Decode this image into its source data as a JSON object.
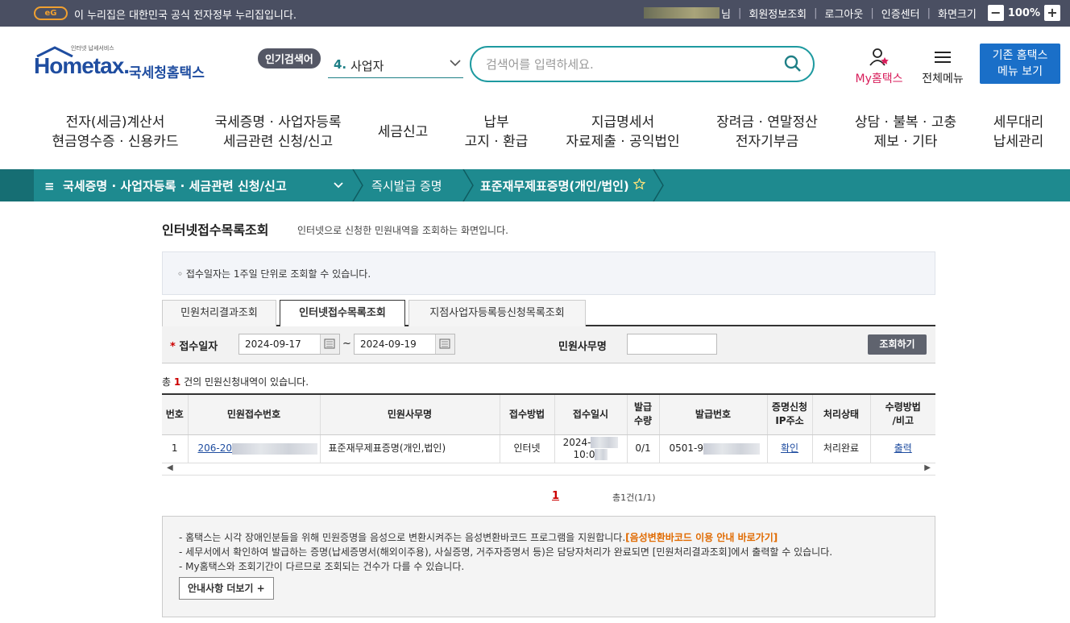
{
  "topbar": {
    "gov_text": "이 누리집은 대한민국 공식 전자정부 누리집입니다.",
    "eg_logo": "eG",
    "user_suffix": "님",
    "links": [
      "회원정보조회",
      "로그아웃",
      "인증센터",
      "화면크기"
    ],
    "zoom_minus": "−",
    "zoom_value": "100%",
    "zoom_plus": "+"
  },
  "header": {
    "logo_small": "인터넷 납세서비스",
    "logo_word": "Hometax.",
    "logo_kor": "국세청홈택스",
    "popular": "인기검색어",
    "rank_no": "4.",
    "rank_text": "사업자",
    "search_placeholder": "검색어를 입력하세요.",
    "my_label": "My홈택스",
    "all_menu": "전체메뉴",
    "old_btn_1": "기존 홈택스",
    "old_btn_2": "메뉴 보기"
  },
  "gnb": [
    {
      "l1": "전자(세금)계산서",
      "l2": "현금영수증 · 신용카드"
    },
    {
      "l1": "국세증명 · 사업자등록",
      "l2": "세금관련 신청/신고"
    },
    {
      "l1": "세금신고",
      "l2": ""
    },
    {
      "l1": "납부",
      "l2": "고지 · 환급"
    },
    {
      "l1": "지급명세서",
      "l2": "자료제출 · 공익법인"
    },
    {
      "l1": "장려금 · 연말정산",
      "l2": "전자기부금"
    },
    {
      "l1": "상담 · 불복 · 고충",
      "l2": "제보 · 기타"
    },
    {
      "l1": "세무대리",
      "l2": "납세관리"
    }
  ],
  "breadcrumb": {
    "menu": "≡",
    "item1": "국세증명 · 사업자등록 · 세금관련 신청/신고",
    "item2": "즉시발급 증명",
    "item3": "표준재무제표증명(개인/법인)"
  },
  "page": {
    "title": "인터넷접수목록조회",
    "desc": "인터넷으로 신청한 민원내역을 조회하는 화면입니다.",
    "notice": "◦ 접수일자는 1주일 단위로 조회할 수 있습니다."
  },
  "tabs": [
    "민원처리결과조회",
    "인터넷접수목록조회",
    "지점사업자등록등신청목록조회"
  ],
  "filter": {
    "req": "*",
    "date_label": "접수일자",
    "date_from": "2024-09-17",
    "tilde": "~",
    "date_to": "2024-09-19",
    "name_label": "민원사무명",
    "search_btn": "조회하기"
  },
  "count": {
    "pre": "총",
    "num": "1",
    "post": "건의 민원신청내역이 있습니다."
  },
  "table": {
    "headers": [
      "번호",
      "민원접수번호",
      "민원사무명",
      "접수방법",
      "접수일시",
      "발급\n수량",
      "발급번호",
      "증명신청\nIP주소",
      "처리상태",
      "수령방법\n/비고"
    ],
    "row": {
      "no": "1",
      "receipt": "206-20",
      "name": "표준재무제표증명(개인,법인)",
      "method": "인터넷",
      "date1": "2024-",
      "date2": "10:0",
      "qty": "0/1",
      "issue": "0501-9",
      "ip": "확인",
      "status": "처리완료",
      "receive": "출력"
    }
  },
  "scroll": {
    "left": "◀",
    "right": "▶"
  },
  "pager": {
    "page": "1",
    "total": "총1건(1/1)"
  },
  "info": {
    "line1a": "- 홈택스는 시각 장애인분들을 위해 민원증명을 음성으로 변환시켜주는 음성변환바코드 프로그램을 지원합니다.",
    "line1b": "[음성변환바코드 이용 안내 바로가기]",
    "line2": "- 세무서에서 확인하여 발급하는 증명(납세증명서(해외이주용), 사실증명, 거주자증명서 등)은 담당자처리가 완료되면 [민원처리결과조회]에서 출력할 수 있습니다.",
    "line3": "- My홈택스와 조회기간이 다르므로 조회되는 건수가 다를 수 있습니다.",
    "more": "안내사항 더보기 +"
  }
}
